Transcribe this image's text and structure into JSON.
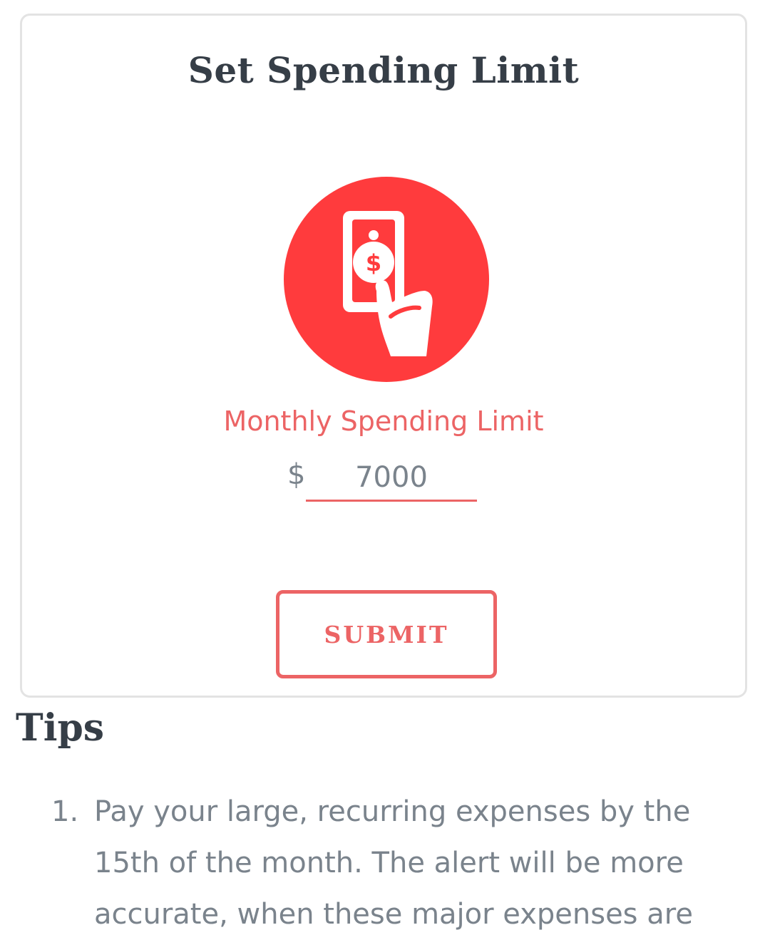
{
  "card": {
    "title": "Set Spending Limit",
    "icon": "hand-holding-cash-icon",
    "accent_color": "#ff3b3d",
    "field": {
      "label": "Monthly Spending Limit",
      "currency_symbol": "$",
      "value": "7000"
    },
    "submit_label": "SUBMIT"
  },
  "tips": {
    "heading": "Tips",
    "items": [
      {
        "number": "1.",
        "text": "Pay your large, recurring expenses by the 15th of the month. The alert will be more accurate, when these major expenses are"
      }
    ]
  }
}
